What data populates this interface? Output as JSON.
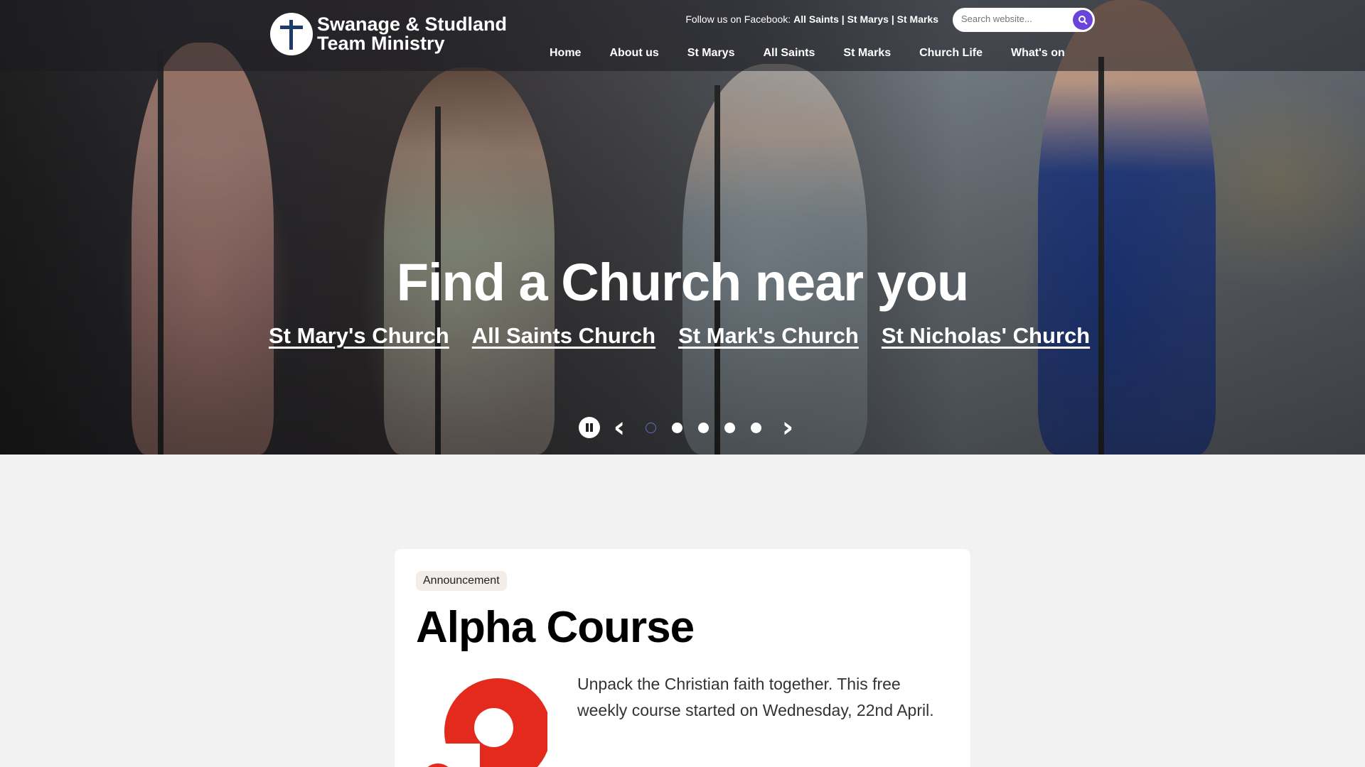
{
  "site": {
    "logo_text": [
      "Swanage & Studland",
      "Team Ministry"
    ],
    "logo_icon": "cross-logo-icon"
  },
  "social": {
    "prefix": "Follow us on Facebook:",
    "links": [
      "All Saints",
      "St Marys",
      "St Marks"
    ],
    "separator": "|"
  },
  "search": {
    "placeholder": "Search website...",
    "icon": "search-icon",
    "button_color": "#6a44d9"
  },
  "nav": {
    "items": [
      "Home",
      "About us",
      "St Marys",
      "All Saints",
      "St Marks",
      "Church Life",
      "What's on"
    ]
  },
  "hero": {
    "title": "Find a Church near you",
    "links": [
      "St Mary's Church",
      "All Saints Church",
      "St Mark's Church",
      "St Nicholas' Church"
    ]
  },
  "slider": {
    "pause_icon": "pause-icon",
    "prev_icon": "chevron-left-icon",
    "next_icon": "chevron-right-icon",
    "slide_count": 5,
    "active_index": 0
  },
  "card": {
    "tag": "Announcement",
    "title": "Alpha Course",
    "logo_icon": "alpha-question-mark-icon",
    "accent_color": "#e42a1d",
    "body": "Unpack the Christian faith together. This free weekly course started on Wednesday, 22nd April."
  }
}
